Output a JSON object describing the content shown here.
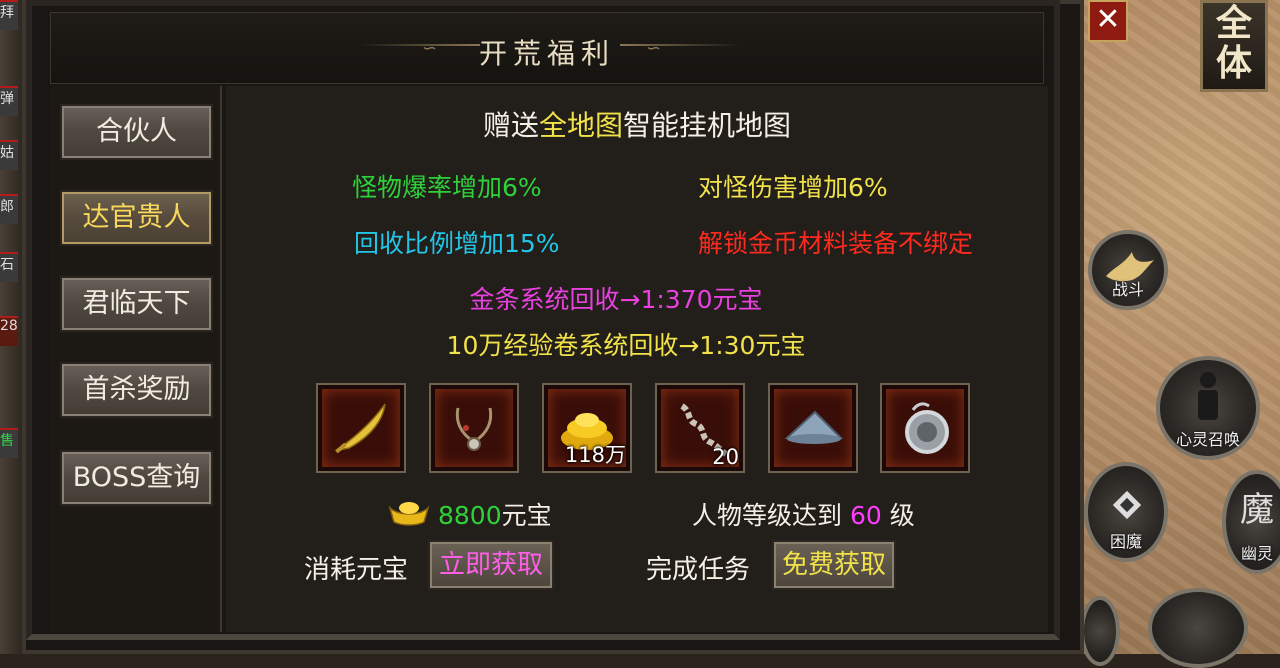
{
  "panel_title": "开荒福利",
  "close_glyph": "✕",
  "whole_label": "全体",
  "left_strip_glyphs": [
    "拜",
    "弹",
    "姑",
    "郎",
    "石",
    "28",
    "售"
  ],
  "sidebar": {
    "items": [
      {
        "label": "合伙人",
        "active": false
      },
      {
        "label": "达官贵人",
        "active": true
      },
      {
        "label": "君临天下",
        "active": false
      },
      {
        "label": "首杀奖励",
        "active": false
      },
      {
        "label": "BOSS查询",
        "active": false
      }
    ]
  },
  "header_line": {
    "prefix": "赠送",
    "highlight": "全地图",
    "suffix": "智能挂机地图"
  },
  "benefits": {
    "drop_rate": "怪物爆率增加6%",
    "damage": "对怪伤害增加6%",
    "recycle": "回收比例增加15%",
    "unbind": "解锁金币材料装备不绑定"
  },
  "recycle_lines": {
    "gold_bar": "金条系统回收→1:370元宝",
    "exp_scroll": "10万经验卷系统回收→1:30元宝"
  },
  "items": [
    {
      "icon": "golden-saber-icon",
      "count": ""
    },
    {
      "icon": "necklace-icon",
      "count": ""
    },
    {
      "icon": "gold-coins-icon",
      "count": "118万"
    },
    {
      "icon": "chain-icon",
      "count": "20"
    },
    {
      "icon": "bamboo-hat-icon",
      "count": ""
    },
    {
      "icon": "medal-icon",
      "count": ""
    }
  ],
  "cost": {
    "amount": "8800",
    "unit": "元宝",
    "label": "消耗元宝",
    "button": "立即获取"
  },
  "level_req": {
    "prefix": "人物等级达到 ",
    "level": "60",
    "suffix": " 级",
    "label": "完成任务",
    "button": "免费获取"
  },
  "right_buttons": [
    {
      "label": "战斗",
      "icon": "battle-icon"
    },
    {
      "label": "心灵召唤",
      "icon": "summon-icon"
    },
    {
      "label": "困魔",
      "icon": "trap-icon"
    },
    {
      "label": "幽灵",
      "glyph": "魔"
    }
  ],
  "colors": {
    "green": "#2fd13a",
    "yellow": "#f2e24a",
    "cyan": "#22c6e8",
    "red": "#ff2a1f",
    "magenta": "#e940e0",
    "level": "#ff3cff"
  }
}
